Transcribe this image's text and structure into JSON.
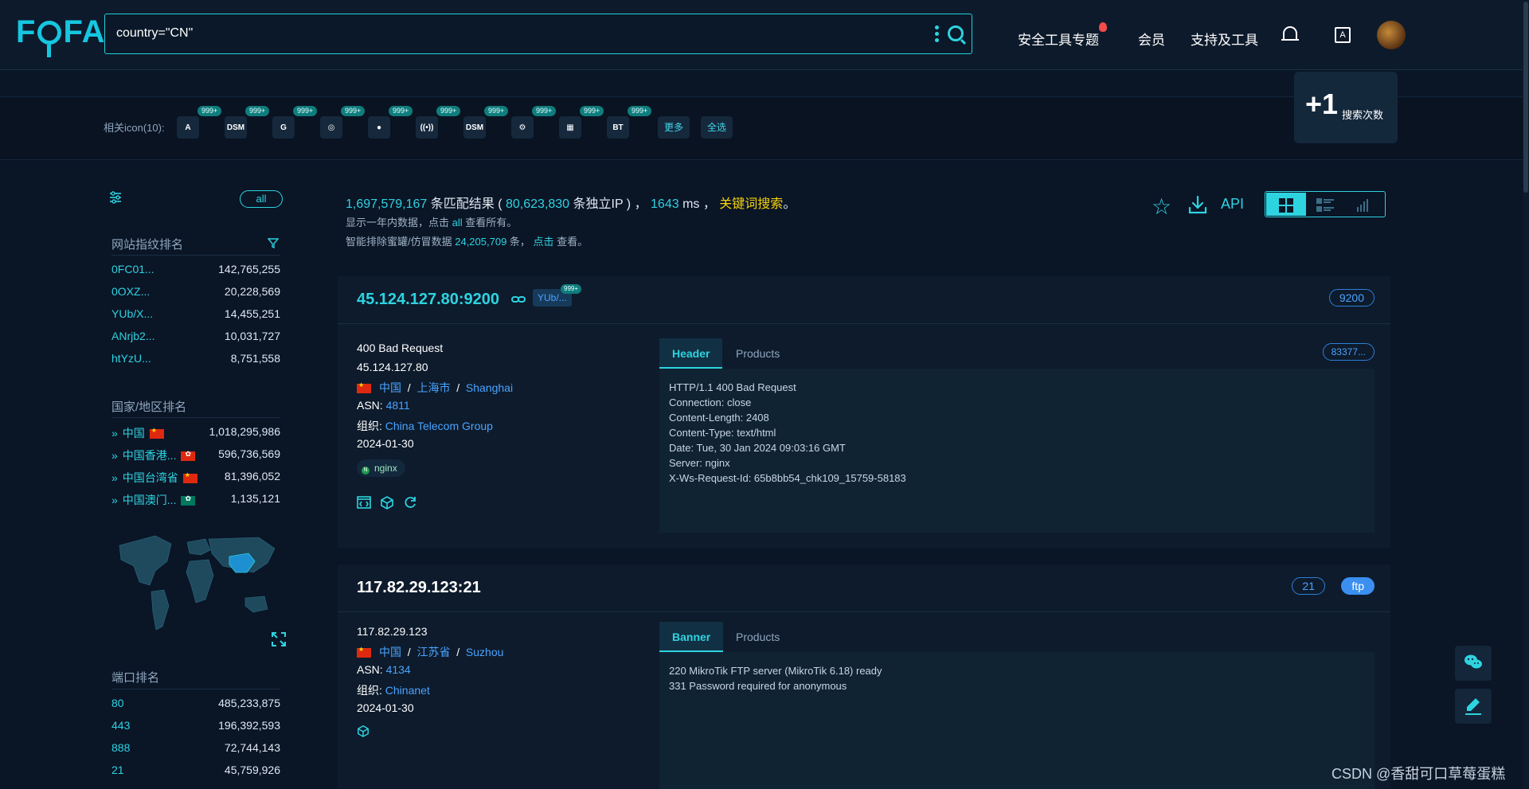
{
  "header": {
    "logo": "FOFA",
    "query": "country=\"CN\"",
    "nav": [
      "安全工具专题",
      "会员",
      "支持及工具"
    ]
  },
  "icon_row": {
    "label": "相关icon(10):",
    "badge": "999+",
    "icons": [
      "A",
      "DSM",
      "G",
      "◎",
      "●",
      "((•))",
      "DSM",
      "⚙",
      "▦",
      "BT"
    ],
    "more": "更多",
    "select_all": "全选"
  },
  "plus_one": {
    "value": "+1",
    "label": "搜索次数"
  },
  "sidebar": {
    "all": "all",
    "fingerprint": {
      "title": "网站指纹排名",
      "items": [
        {
          "k": "0FC01...",
          "v": "142,765,255"
        },
        {
          "k": "0OXZ...",
          "v": "20,228,569"
        },
        {
          "k": "YUb/X...",
          "v": "14,455,251"
        },
        {
          "k": "ANrjb2...",
          "v": "10,031,727"
        },
        {
          "k": "htYzU...",
          "v": "8,751,558"
        }
      ]
    },
    "country": {
      "title": "国家/地区排名",
      "items": [
        {
          "k": "中国",
          "v": "1,018,295,986",
          "flag": "cn"
        },
        {
          "k": "中国香港...",
          "v": "596,736,569",
          "flag": "hk"
        },
        {
          "k": "中国台湾省",
          "v": "81,396,052",
          "flag": "cn"
        },
        {
          "k": "中国澳门...",
          "v": "1,135,121",
          "flag": "mo"
        }
      ]
    },
    "port": {
      "title": "端口排名",
      "items": [
        {
          "k": "80",
          "v": "485,233,875"
        },
        {
          "k": "443",
          "v": "196,392,593"
        },
        {
          "k": "888",
          "v": "72,744,143"
        },
        {
          "k": "21",
          "v": "45,759,926"
        }
      ]
    }
  },
  "summary": {
    "total": "1,697,579,167",
    "t1": " 条匹配结果 ( ",
    "ips": "80,623,830",
    "t2": " 条独立IP ) ， ",
    "ms": "1643",
    "t3": " ms ， ",
    "kw": "关键词搜索",
    "t4": "。",
    "line2a": "显示一年内数据，点击 ",
    "line2b": "all",
    "line2c": " 查看所有。",
    "line3a": "智能排除蜜罐/仿冒数据 ",
    "line3b": "24,205,709",
    "line3c": " 条， ",
    "line3d": "点击",
    "line3e": " 查看。",
    "api": "API"
  },
  "results": [
    {
      "host": "45.124.127.80:9200",
      "tag": "YUb/...",
      "tag_badge": "999+",
      "port": "9200",
      "title": "400 Bad Request",
      "ip": "45.124.127.80",
      "country": "中国",
      "sep": "/",
      "region": "上海市",
      "city": "Shanghai",
      "asn_label": "ASN:",
      "asn": "4811",
      "org_label": "组织:",
      "org": "China Telecom Group",
      "date": "2024-01-30",
      "product": "nginx",
      "tab1": "Header",
      "tab2": "Products",
      "hash": "83377...",
      "lines": [
        "HTTP/1.1 400 Bad Request",
        "Connection: close",
        "Content-Length: 2408",
        "Content-Type: text/html",
        "Date: Tue, 30 Jan 2024 09:03:16 GMT",
        "Server: nginx",
        "X-Ws-Request-Id: 65b8bb54_chk109_15759-58183"
      ]
    },
    {
      "host": "117.82.29.123:21",
      "port": "21",
      "proto": "ftp",
      "ip": "117.82.29.123",
      "country": "中国",
      "sep": "/",
      "region": "江苏省",
      "city": "Suzhou",
      "asn_label": "ASN:",
      "asn": "4134",
      "org_label": "组织:",
      "org": "Chinanet",
      "date": "2024-01-30",
      "tab1": "Banner",
      "tab2": "Products",
      "lines": [
        "220 MikroTik FTP server (MikroTik 6.18) ready",
        "331 Password required for anonymous"
      ]
    }
  ],
  "watermark": "CSDN @香甜可口草莓蛋糕",
  "colors": {
    "accent": "#2ed3e0",
    "link": "#4aa3ff",
    "keyword": "#f5d20b",
    "bg": "#0a1526"
  }
}
